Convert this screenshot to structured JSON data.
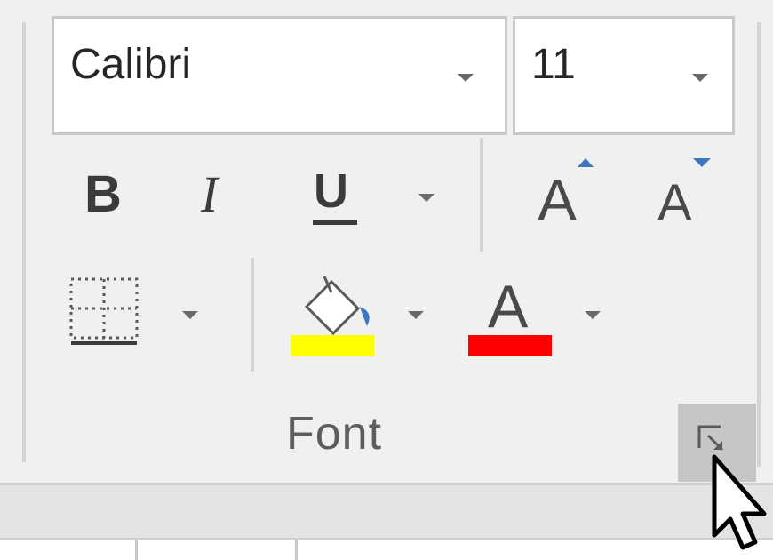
{
  "font_group": {
    "label": "Font",
    "font_name": {
      "value": "Calibri"
    },
    "font_size": {
      "value": "11"
    },
    "buttons": {
      "bold": "B",
      "italic": "I",
      "underline": "U",
      "grow_font": "A",
      "shrink_font": "A",
      "font_color": "A"
    },
    "fill_color": "#ffff00",
    "font_color_swatch": "#ff0000",
    "accent_arrow": "#3e77c0"
  }
}
